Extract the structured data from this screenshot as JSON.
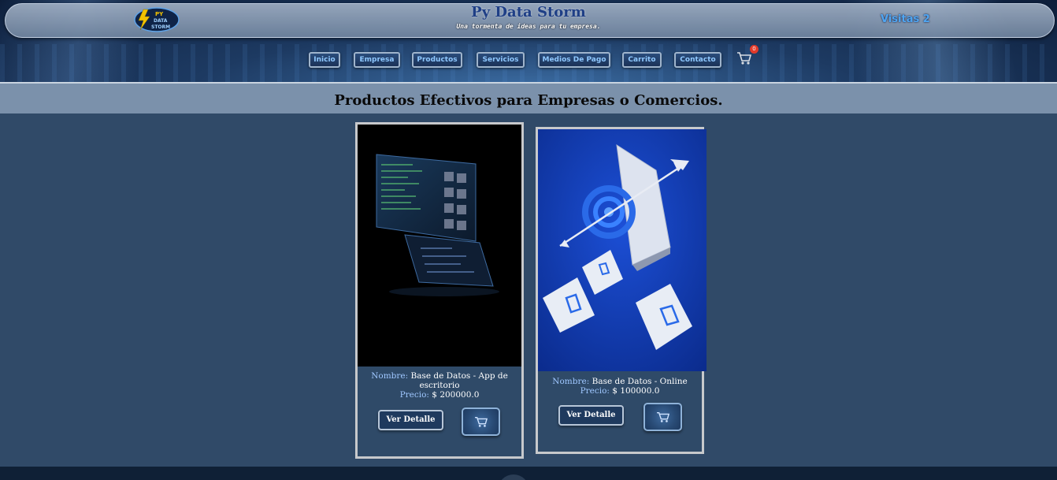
{
  "header": {
    "site_title": "Py Data Storm",
    "subtitle": "Una tormenta de ideas para tu empresa.",
    "visits_label": "Visitas 2",
    "logo_alt": "PY DATA STORM",
    "logo_line1": "PY",
    "logo_line2": "DATA",
    "logo_line3": "STORM",
    "cart_count": "0"
  },
  "nav": {
    "items": [
      {
        "label": "Inicio"
      },
      {
        "label": "Empresa"
      },
      {
        "label": "Productos"
      },
      {
        "label": "Servicios"
      },
      {
        "label": "Medios De Pago"
      },
      {
        "label": "Carrito"
      },
      {
        "label": "Contacto"
      }
    ]
  },
  "section": {
    "title": "Productos Efectivos para Empresas o Comercios."
  },
  "products": [
    {
      "name_label": "Nombre:",
      "name": " Base de Datos - App de escritorio",
      "price_label": "Precio:",
      "price": " $ 200000.0",
      "detail_label": "Ver Detalle",
      "image_icon": "desktop-app-screens-image"
    },
    {
      "name_label": "Nombre:",
      "name": " Base de Datos - Online",
      "price_label": "Precio:",
      "price": " $ 100000.0",
      "detail_label": "Ver Detalle",
      "image_icon": "online-shopping-target-image"
    }
  ],
  "colors": {
    "page_bg": "#304a68",
    "section_bg": "#7b91ab",
    "accent_label": "#9fc7ff",
    "title_blue": "#1f3f86"
  }
}
